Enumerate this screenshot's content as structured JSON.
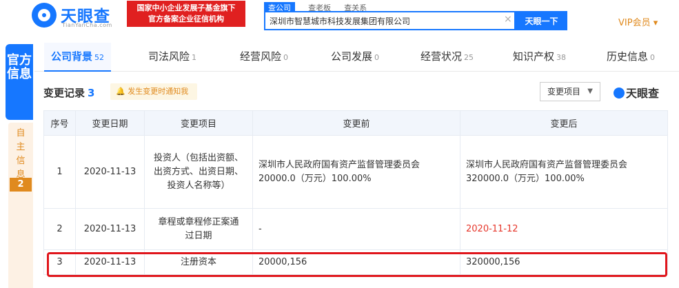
{
  "header": {
    "logo_text": "天眼查",
    "logo_sub": "TianYanCha.com",
    "promo_line1": "国家中小企业发展子基金旗下",
    "promo_line2": "官方备案企业征信机构",
    "search_tabs": [
      "查公司",
      "查老板",
      "查关系"
    ],
    "search_value": "深圳市智慧城市科技发展集团有限公司",
    "search_button": "天眼一下",
    "vip_label": "VIP会员"
  },
  "ribbon": {
    "official": "官方信息",
    "self": "自主信息",
    "self_count": "2"
  },
  "category_tabs": [
    {
      "label": "公司背景",
      "count": "52"
    },
    {
      "label": "司法风险",
      "count": "1"
    },
    {
      "label": "经营风险",
      "count": "0"
    },
    {
      "label": "公司发展",
      "count": "0"
    },
    {
      "label": "经营状况",
      "count": "25"
    },
    {
      "label": "知识产权",
      "count": "38"
    },
    {
      "label": "历史信息",
      "count": "0"
    }
  ],
  "section": {
    "title": "变更记录",
    "count": "3",
    "notify": "发生变更时通知我",
    "sort_label": "变更项目",
    "brand": "天眼查"
  },
  "table": {
    "headers": [
      "序号",
      "变更日期",
      "变更项目",
      "变更前",
      "变更后"
    ],
    "rows": [
      {
        "no": "1",
        "date": "2020-11-13",
        "item": "投资人（包括出资额、出资方式、出资日期、投资人名称等）",
        "before": "深圳市人民政府国有资产监督管理委员会 20000.0（万元）100.00%",
        "after": "深圳市人民政府国有资产监督管理委员会 320000.0（万元）100.00%"
      },
      {
        "no": "2",
        "date": "2020-11-13",
        "item": "章程或章程修正案通过日期",
        "before": "-",
        "after": "2020-11-12"
      },
      {
        "no": "3",
        "date": "2020-11-13",
        "item": "注册资本",
        "before": "20000,156",
        "after": "320000,156"
      }
    ]
  },
  "colors": {
    "brand_blue": "#1677ff",
    "promo_red": "#e02020",
    "highlight_red": "#e0151b",
    "accent_orange": "#e08a1e"
  }
}
